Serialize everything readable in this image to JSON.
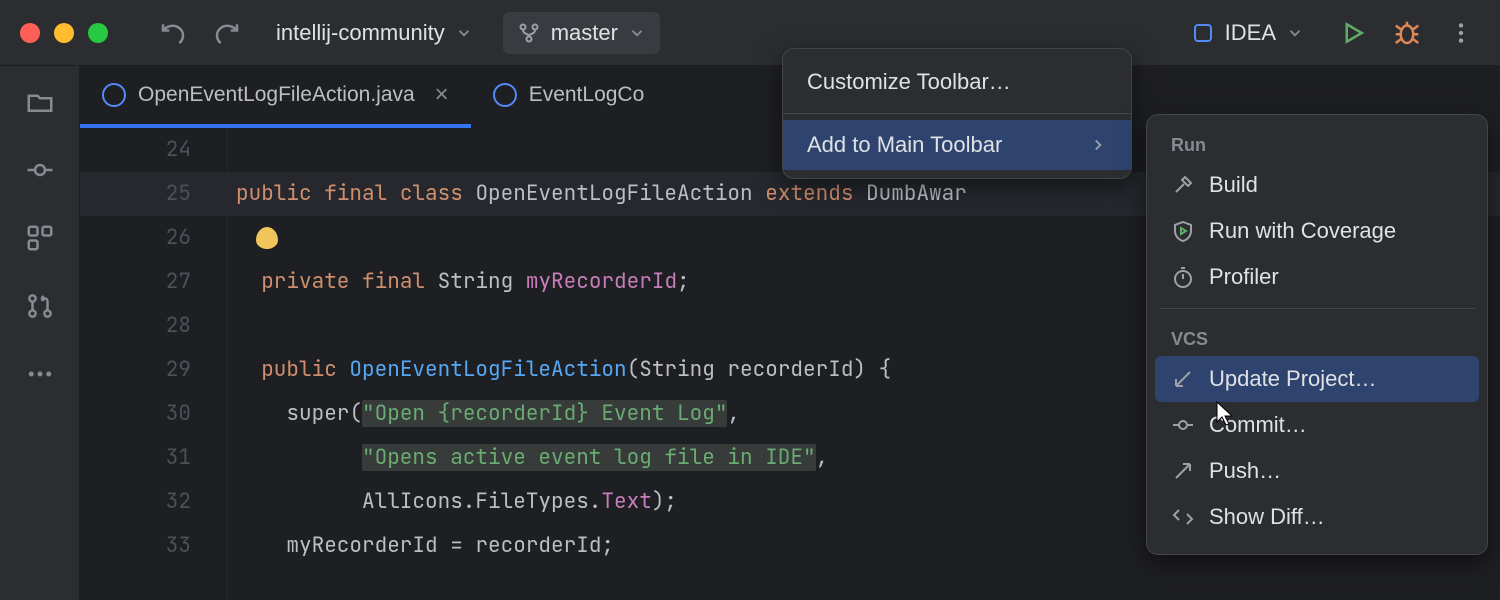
{
  "titlebar": {
    "project": "intellij-community",
    "branch": "master",
    "run_config": "IDEA"
  },
  "tabs": [
    {
      "label": "OpenEventLogFileAction.java",
      "active": true
    },
    {
      "label": "EventLogCo",
      "active": false
    }
  ],
  "gutter_start": 24,
  "code": {
    "l25": {
      "kw1": "public",
      "kw2": "final",
      "kw3": "class",
      "name": "OpenEventLogFileAction",
      "kw4": "extends",
      "base": "DumbAwar"
    },
    "l27": {
      "kw1": "private",
      "kw2": "final",
      "type": "String",
      "field": "myRecorderId",
      "semi": ";"
    },
    "l29": {
      "kw1": "public",
      "ctor": "OpenEventLogFileAction",
      "params": "(String recorderId) {"
    },
    "l30": {
      "call": "super",
      "open": "(",
      "str": "\"Open {recorderId} Event Log\"",
      "comma": ","
    },
    "l31": {
      "str": "\"Opens active event log file in IDE\"",
      "comma": ","
    },
    "l32": {
      "expr": "AllIcons.FileTypes.",
      "field": "Text",
      "close": ");"
    },
    "l33": {
      "lhs": "myRecorderId",
      "eq": " = ",
      "rhs": "recorderId;"
    }
  },
  "popup": {
    "customize": "Customize Toolbar…",
    "add": "Add to Main Toolbar"
  },
  "submenu": {
    "run_header": "Run",
    "build": "Build",
    "coverage": "Run with Coverage",
    "profiler": "Profiler",
    "vcs_header": "VCS",
    "update": "Update Project…",
    "commit": "Commit…",
    "push": "Push…",
    "diff": "Show Diff…"
  }
}
